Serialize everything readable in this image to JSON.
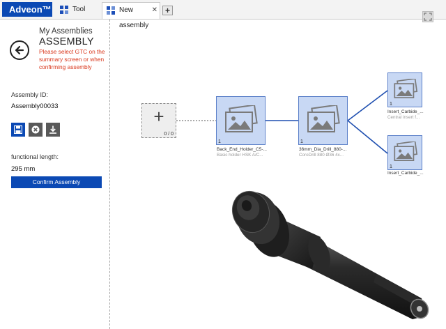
{
  "brand": {
    "name": "Adveon™"
  },
  "tabs": [
    {
      "label": "Tool Library"
    },
    {
      "label": "New assembly",
      "close": "✕"
    }
  ],
  "add_tab": "+",
  "left_panel": {
    "heading": "My Assemblies",
    "title": "ASSEMBLY",
    "warning": "Please select GTC on the summary screen or when confirming assembly",
    "assembly_id_label": "Assembly ID:",
    "assembly_id": "Assembly00033",
    "functional_length_label": "functional length:",
    "functional_length": "295 mm",
    "confirm_label": "Confirm Assembly"
  },
  "diagram": {
    "add_node": {
      "symbol": "+",
      "ratio": "0 / 0"
    },
    "nodes": [
      {
        "num": "1",
        "label": "Back_End_Holder_C5-...",
        "sub": "Basic holder HSK A/C..."
      },
      {
        "num": "1",
        "label": "36mm_Dia_Drill_880-...",
        "sub": "CoroDrill 880 Ø36 4x..."
      },
      {
        "num": "1",
        "label": "Insert_Carbide_...",
        "sub": "Central insert f..."
      },
      {
        "num": "1",
        "label": "Insert_Carbide_...",
        "sub": ""
      }
    ]
  },
  "icons": {
    "back": "arrow-left-icon",
    "save": "save-icon",
    "cancel": "cancel-icon",
    "download": "download-icon",
    "fullscreen": "fullscreen-icon",
    "placeholder": "image-placeholder-icon"
  },
  "colors": {
    "brand_blue": "#0b49b4",
    "warning_red": "#d9361b",
    "node_fill": "#c8d8f4",
    "connector": "#1f4fb0"
  }
}
